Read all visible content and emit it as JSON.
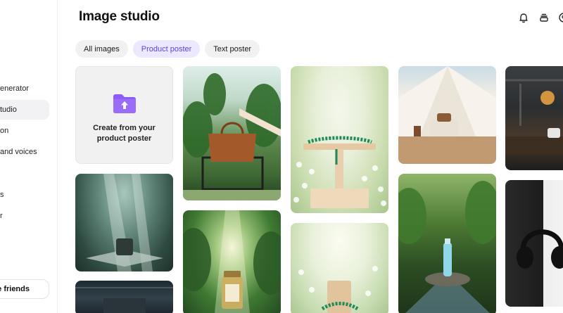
{
  "sidebar": {
    "items": [
      {
        "label": "enerator",
        "active": false
      },
      {
        "label": "tudio",
        "active": true
      },
      {
        "label": "on",
        "active": false
      },
      {
        "label": "and voices",
        "active": false
      },
      {
        "label": "s",
        "active": false
      },
      {
        "label": "r",
        "active": false
      }
    ],
    "invite_label": "e friends"
  },
  "header": {
    "title": "Image studio",
    "icons": [
      "bell-icon",
      "layers-icon",
      "profile-icon"
    ]
  },
  "tabs": [
    {
      "label": "All images",
      "active": false
    },
    {
      "label": "Product poster",
      "active": true
    },
    {
      "label": "Text poster",
      "active": false
    }
  ],
  "create_card": {
    "label": "Create from your product poster",
    "icon": "folder-upload-icon",
    "icon_color": "#8b5cf6"
  },
  "gallery": [
    {
      "name": "greenhouse-bag"
    },
    {
      "name": "flowers-necklace-stand"
    },
    {
      "name": "tent-armchair"
    },
    {
      "name": "industrial-earbuds"
    },
    {
      "name": "forest-pedestal"
    },
    {
      "name": "jungle-perfume"
    },
    {
      "name": "flowers-bracelet-stand"
    },
    {
      "name": "stream-bottle"
    },
    {
      "name": "bw-headphones"
    },
    {
      "name": "dark-interior"
    }
  ],
  "colors": {
    "accent": "#5b43d6",
    "accent_bg": "#ece8ff",
    "tab_bg": "#f1f1f2"
  }
}
